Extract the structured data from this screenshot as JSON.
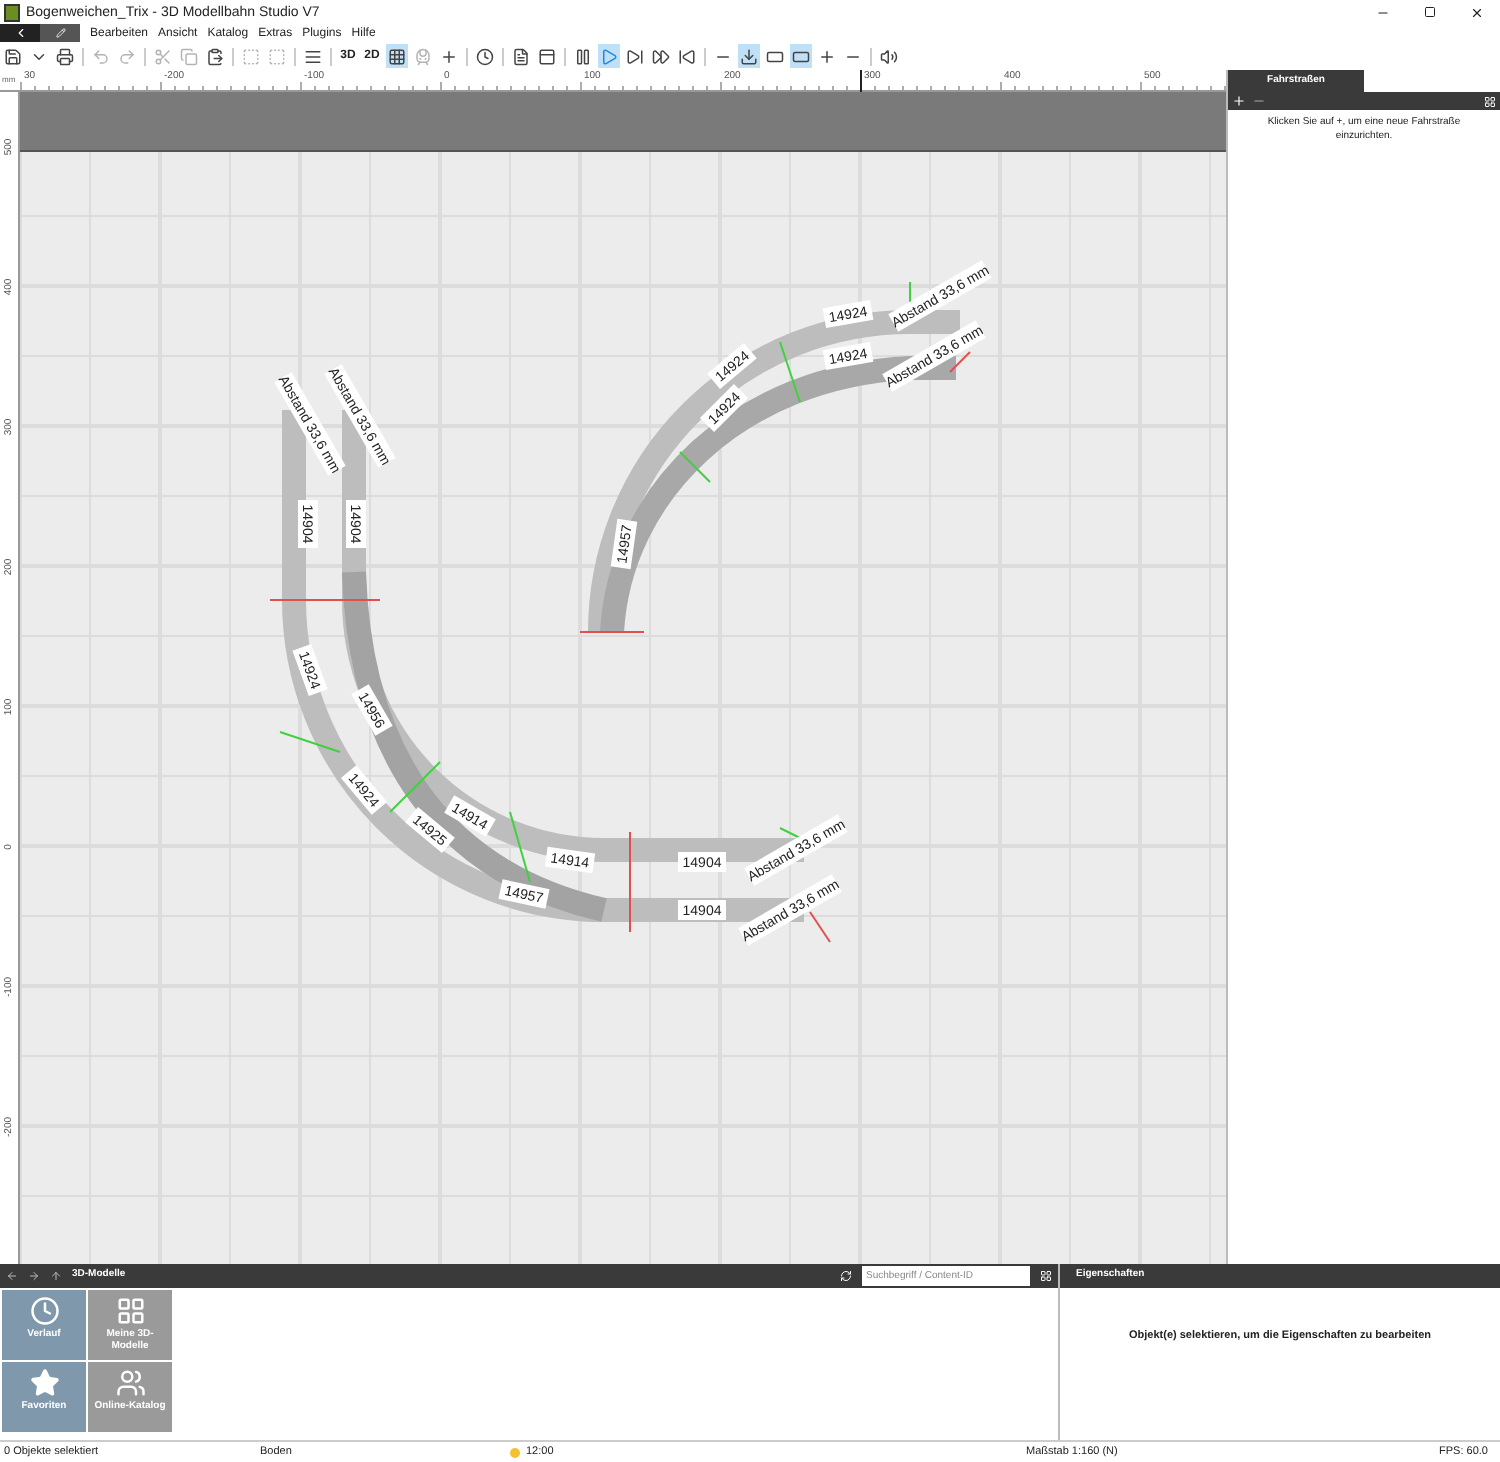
{
  "window": {
    "title": "Bogenweichen_Trix - 3D Modellbahn Studio V7"
  },
  "menu": [
    "Bearbeiten",
    "Ansicht",
    "Katalog",
    "Extras",
    "Plugins",
    "Hilfe"
  ],
  "toolbar": [
    {
      "kind": "icon",
      "selected": false,
      "disabled": false
    },
    {
      "kind": "icon",
      "selected": false,
      "disabled": false
    },
    {
      "kind": "icon",
      "selected": false,
      "disabled": false
    },
    {
      "kind": "sep"
    },
    {
      "kind": "icon",
      "selected": false,
      "disabled": true
    },
    {
      "kind": "icon",
      "selected": false,
      "disabled": true
    },
    {
      "kind": "sep"
    },
    {
      "kind": "icon",
      "selected": false,
      "disabled": true
    },
    {
      "kind": "icon",
      "selected": false,
      "disabled": true
    },
    {
      "kind": "icon",
      "selected": false,
      "disabled": false
    },
    {
      "kind": "sep"
    },
    {
      "kind": "icon",
      "selected": false,
      "disabled": true
    },
    {
      "kind": "icon",
      "selected": false,
      "disabled": true
    },
    {
      "kind": "sep"
    },
    {
      "kind": "icon",
      "selected": false,
      "disabled": false
    },
    {
      "kind": "sep"
    },
    {
      "kind": "text",
      "label": "3D",
      "selected": false,
      "disabled": false
    },
    {
      "kind": "text",
      "label": "2D",
      "selected": false,
      "disabled": false
    },
    {
      "kind": "icon",
      "selected": true,
      "disabled": false
    },
    {
      "kind": "icon",
      "selected": false,
      "disabled": true
    },
    {
      "kind": "icon",
      "selected": false,
      "disabled": false
    },
    {
      "kind": "sep"
    },
    {
      "kind": "icon",
      "selected": false,
      "disabled": false
    },
    {
      "kind": "sep"
    },
    {
      "kind": "icon",
      "selected": false,
      "disabled": false
    },
    {
      "kind": "icon",
      "selected": false,
      "disabled": false
    },
    {
      "kind": "sep"
    },
    {
      "kind": "icon",
      "selected": false,
      "disabled": false
    },
    {
      "kind": "icon",
      "selected": true,
      "disabled": false
    },
    {
      "kind": "icon",
      "selected": false,
      "disabled": false
    },
    {
      "kind": "icon",
      "selected": false,
      "disabled": false
    },
    {
      "kind": "icon",
      "selected": false,
      "disabled": false
    },
    {
      "kind": "sep"
    },
    {
      "kind": "icon",
      "selected": false,
      "disabled": false
    },
    {
      "kind": "icon",
      "selected": true,
      "disabled": false
    },
    {
      "kind": "icon",
      "selected": false,
      "disabled": false
    },
    {
      "kind": "icon",
      "selected": true,
      "disabled": false
    },
    {
      "kind": "icon",
      "selected": false,
      "disabled": false
    },
    {
      "kind": "icon",
      "selected": false,
      "disabled": false
    },
    {
      "kind": "sep"
    },
    {
      "kind": "icon",
      "selected": false,
      "disabled": false
    }
  ],
  "ruler": {
    "unit": "mm",
    "x_labels": [
      "30",
      "-200",
      "-100",
      "0",
      "100",
      "200",
      "300",
      "400",
      "500"
    ],
    "y_labels": [
      "500",
      "400",
      "300",
      "200",
      "100",
      "0",
      "-100",
      "-200"
    ]
  },
  "canvas": {
    "track_labels": [
      "14904",
      "14904",
      "14924",
      "14956",
      "14924",
      "14925",
      "14914",
      "14914",
      "14957",
      "14904",
      "14904",
      "14957",
      "14924",
      "14924",
      "14924",
      "14924"
    ],
    "distance_labels": [
      "Abstand 33,6 mm",
      "Abstand 33,6 mm",
      "Abstand 33,6 mm",
      "Abstand 33,6 mm",
      "Abstand 33,6 mm",
      "Abstand 33,6 mm"
    ]
  },
  "routes_panel": {
    "tabs": [
      {
        "label": "Fahrstraßen",
        "selected": true
      }
    ],
    "hint": "Klicken Sie auf +, um eine neue Fahrstraße einzurichten."
  },
  "models_panel": {
    "title": "3D-Modelle",
    "search": {
      "placeholder": "Suchbegriff / Content-ID"
    },
    "tiles": [
      {
        "label": "Verlauf",
        "kind": "history",
        "selected": true
      },
      {
        "label": "Meine 3D-Modelle",
        "kind": "grid",
        "selected": false
      },
      {
        "label": "Favoriten",
        "kind": "star",
        "selected": true
      },
      {
        "label": "Online-Katalog",
        "kind": "people",
        "selected": false
      }
    ]
  },
  "properties_panel": {
    "title": "Eigenschaften",
    "hint": "Objekt(e) selektieren, um die Eigenschaften zu bearbeiten"
  },
  "status_bar": {
    "selection": "0 Objekte selektiert",
    "layer": "Boden",
    "time": "12:00",
    "scale": "Maßstab 1:160 (N)",
    "fps": "FPS: 60.0"
  }
}
